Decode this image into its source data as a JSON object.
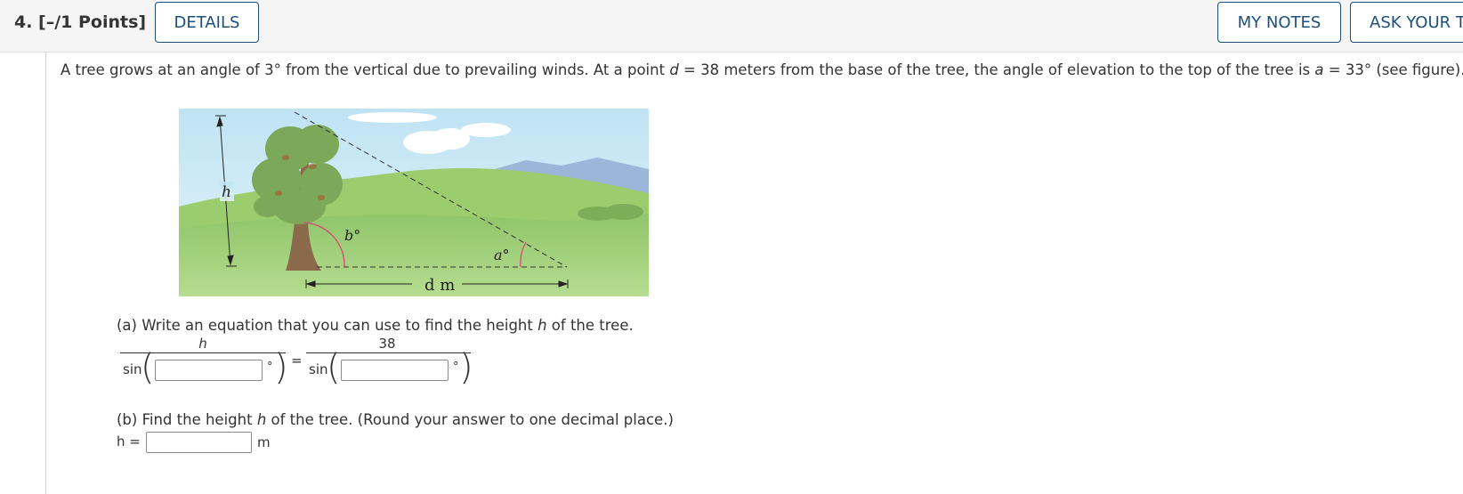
{
  "header": {
    "question_label": "4.  [–/1 Points]",
    "details_label": "DETAILS",
    "my_notes_label": "MY NOTES",
    "ask_label": "ASK YOUR TEACHER"
  },
  "problem": {
    "part1": "A tree grows at an angle of 3° from the vertical due to prevailing winds. At a point ",
    "d_var": "d",
    "part2": " = 38 meters from the base of the tree, the angle of elevation to the top of the tree is ",
    "a_var": "a",
    "part3": " = 33° (see figure)."
  },
  "figure": {
    "h_label": "h",
    "b_label": "b°",
    "a_label": "a°",
    "d_label": "d m"
  },
  "part_a": {
    "text_before": "(a) Write an equation that you can use to find the height ",
    "var": "h",
    "text_after": " of the tree.",
    "left_numerator": "h",
    "right_numerator": "38",
    "sin_label": "sin",
    "deg_symbol": "°",
    "equals": "=",
    "input1_value": "",
    "input2_value": ""
  },
  "part_b": {
    "text_before": "(b) Find the height ",
    "var": "h",
    "text_after": " of the tree. (Round your answer to one decimal place.)",
    "answer_label": "h =",
    "answer_value": "",
    "unit": "m"
  }
}
